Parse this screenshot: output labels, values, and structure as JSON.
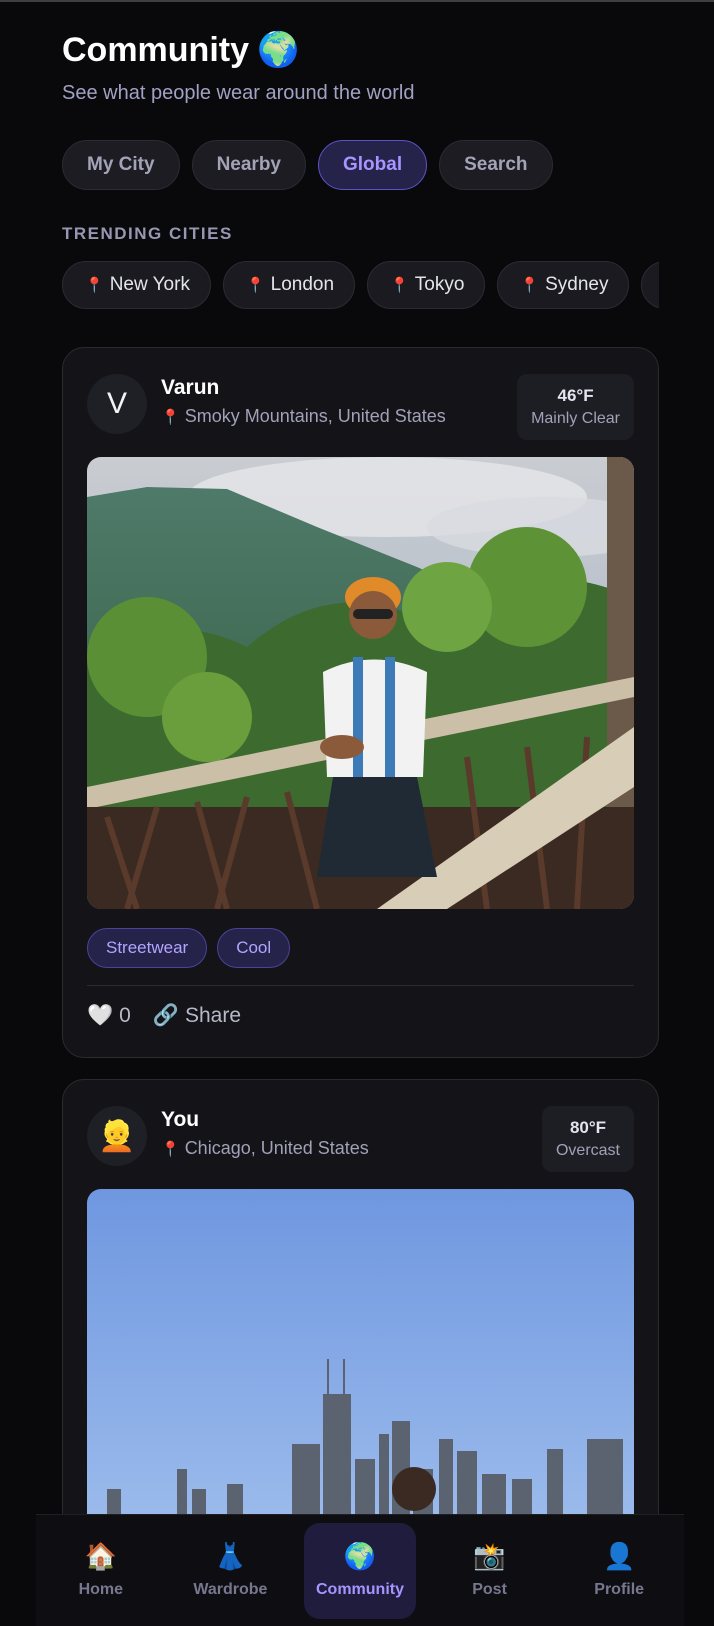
{
  "header": {
    "title": "Community",
    "title_icon": "🌍",
    "subtitle": "See what people wear around the world"
  },
  "tabs": [
    {
      "label": "My City",
      "active": false
    },
    {
      "label": "Nearby",
      "active": false
    },
    {
      "label": "Global",
      "active": true
    },
    {
      "label": "Search",
      "active": false
    }
  ],
  "trending": {
    "label": "TRENDING CITIES",
    "cities": [
      "New York",
      "London",
      "Tokyo",
      "Sydney"
    ]
  },
  "posts": [
    {
      "avatar": "V",
      "name": "Varun",
      "location": "Smoky Mountains, United States",
      "temp": "46°F",
      "condition": "Mainly Clear",
      "tags": [
        "Streetwear",
        "Cool"
      ],
      "likes": "0",
      "share_label": "Share"
    },
    {
      "avatar": "👱",
      "name": "You",
      "location": "Chicago, United States",
      "temp": "80°F",
      "condition": "Overcast"
    }
  ],
  "nav": [
    {
      "icon": "🏠",
      "label": "Home",
      "active": false
    },
    {
      "icon": "👗",
      "label": "Wardrobe",
      "active": false
    },
    {
      "icon": "🌍",
      "label": "Community",
      "active": true
    },
    {
      "icon": "📸",
      "label": "Post",
      "active": false
    },
    {
      "icon": "👤",
      "label": "Profile",
      "active": false
    }
  ],
  "colors": {
    "background": "#09090b",
    "accent": "#a794ff",
    "card": "#131318"
  }
}
